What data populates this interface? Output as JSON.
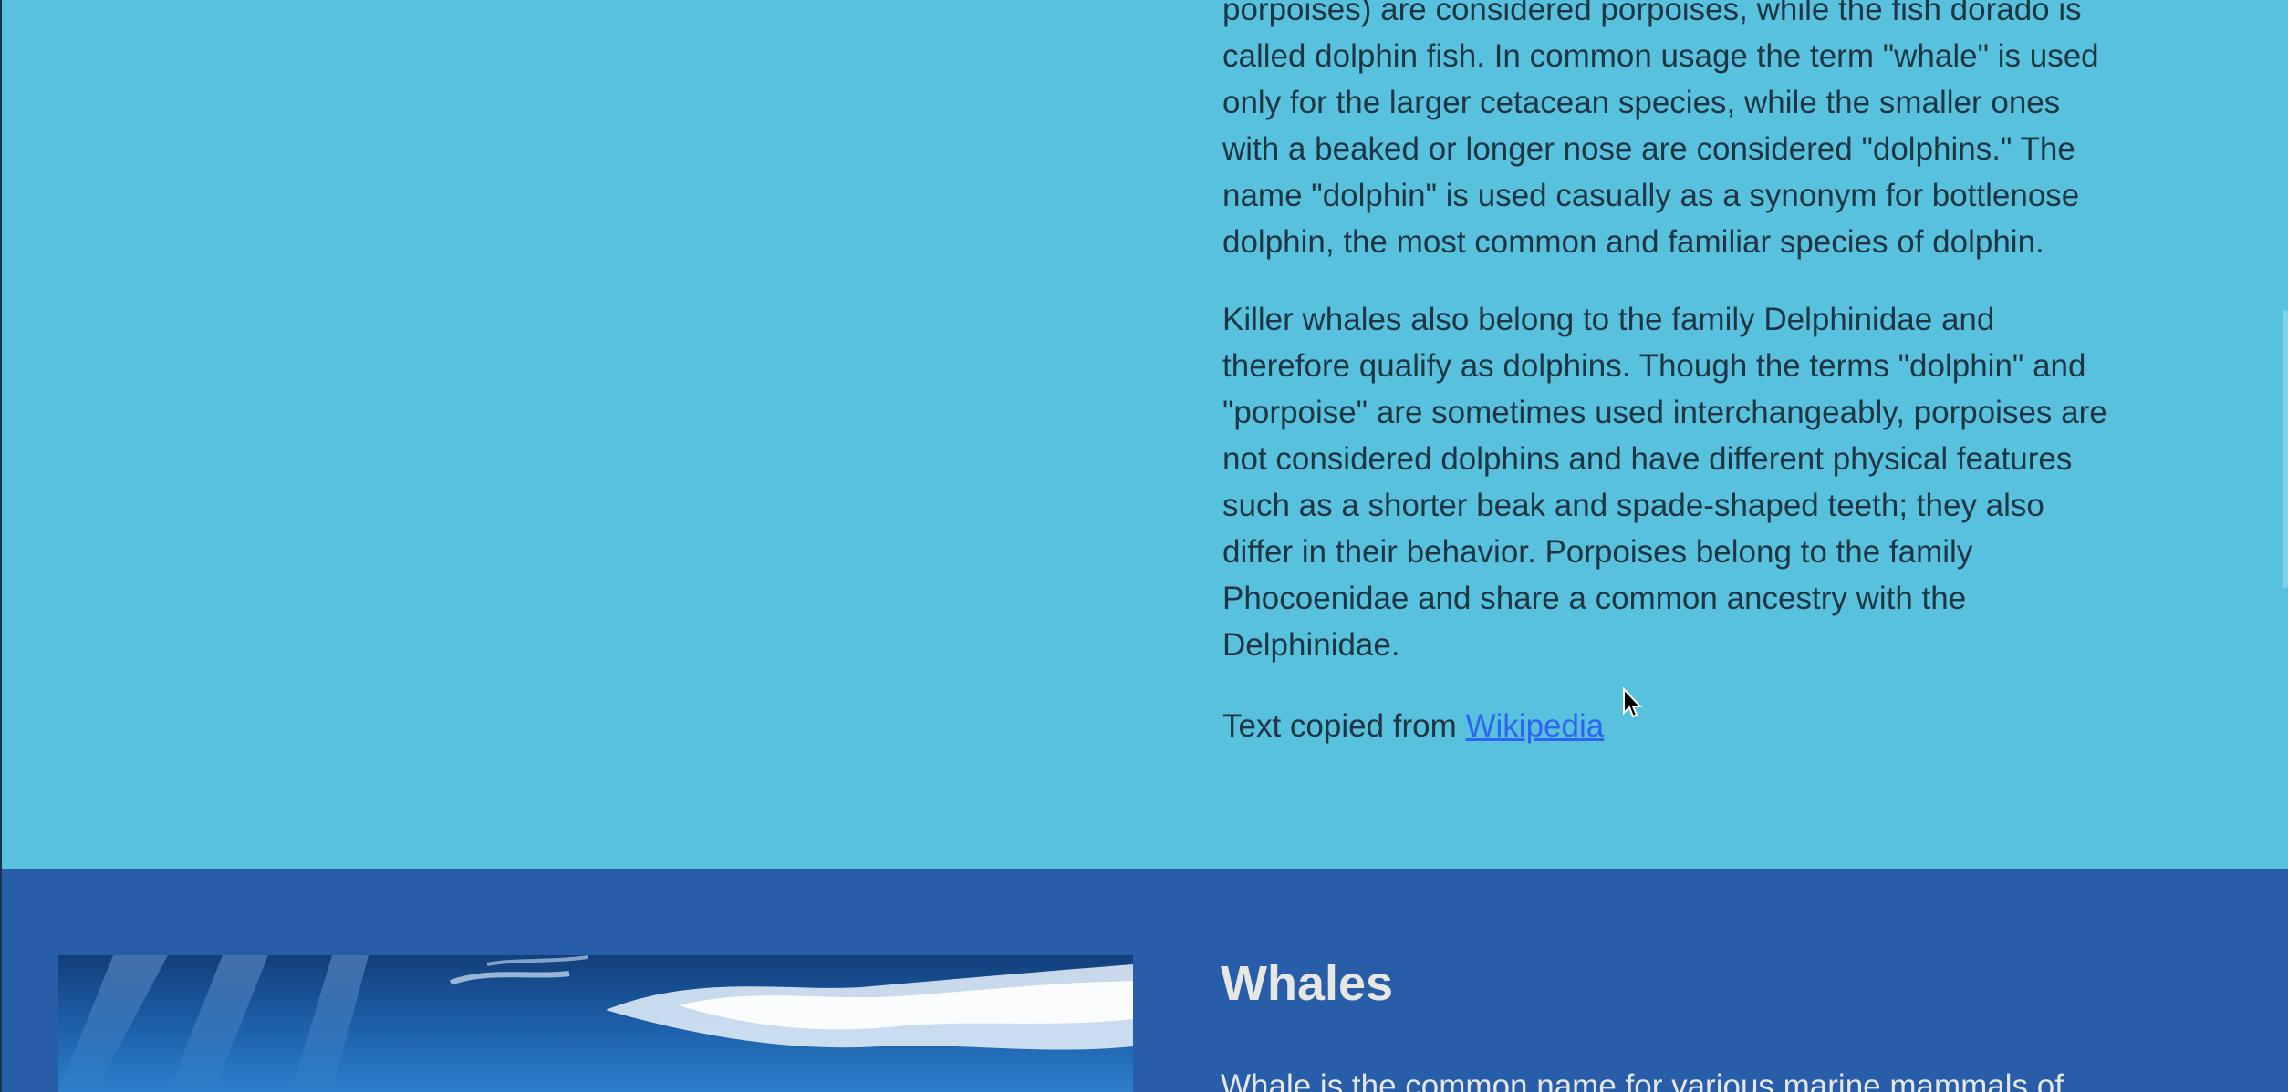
{
  "dolphins": {
    "continued_lines": [
      "porpoises) are considered porpoises, while the fish dorado is",
      "called dolphin fish. In common usage the term \"whale\" is used",
      "only for the larger cetacean species, while the smaller ones",
      "with a beaked or longer nose are considered \"dolphins.\" The",
      "name \"dolphin\" is used casually as a synonym for bottlenose",
      "dolphin, the most common and familiar species of dolphin."
    ],
    "killer_whales_lines": [
      "Killer whales also belong to the family Delphinidae and",
      "therefore qualify as dolphins. Though the terms \"dolphin\" and",
      "\"porpoise\" are sometimes used interchangeably, porpoises are",
      "not considered dolphins and have different physical features",
      "such as a shorter beak and spade-shaped teeth; they also",
      "differ in their behavior. Porpoises belong to the family",
      "Phocoenidae and share a common ancestry with the",
      "Delphinidae."
    ],
    "credit_prefix": "Text copied from ",
    "credit_link": "Wikipedia"
  },
  "whales": {
    "title": "Whales",
    "intro": "Whale is the common name for various marine mammals of"
  },
  "colors": {
    "dolphins_bg": "#58c1dd",
    "whales_bg": "#285daa",
    "link": "#2f63f2",
    "body_text": "#1e3644",
    "whales_text": "#e6e7e3"
  },
  "icons": {
    "cursor": "arrow-cursor-icon"
  }
}
